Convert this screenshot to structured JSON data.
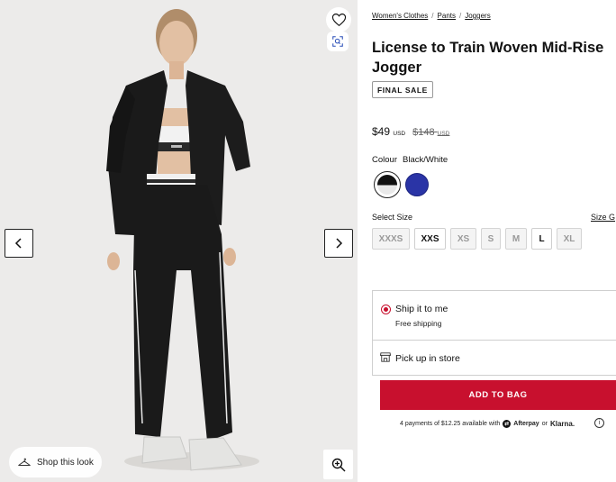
{
  "gallery": {
    "shop_look_label": "Shop this look",
    "icons": {
      "wishlist": "heart-icon",
      "visual_search": "visual-search-icon",
      "prev": "chevron-left-icon",
      "next": "chevron-right-icon",
      "zoom": "zoom-in-icon",
      "shop_look": "hanger-icon"
    }
  },
  "breadcrumb": [
    {
      "label": "Women's Clothes"
    },
    {
      "label": "Pants"
    },
    {
      "label": "Joggers"
    }
  ],
  "breadcrumb_separator": "/",
  "product": {
    "title": "License to Train Woven Mid-Rise Jogger",
    "badge": "FINAL SALE",
    "price_now": "$49",
    "price_now_currency": "USD",
    "price_old": "$148",
    "price_old_currency": "USD",
    "colour_label": "Colour",
    "colour_selected": "Black/White",
    "swatches": [
      {
        "name": "Black/White",
        "color": "#111111",
        "selected": true
      },
      {
        "name": "Blue",
        "color": "#2a34a6",
        "selected": false
      }
    ],
    "size_label": "Select Size",
    "size_guide_label": "Size G",
    "sizes": [
      {
        "label": "XXXS",
        "available": false
      },
      {
        "label": "XXS",
        "available": true
      },
      {
        "label": "XS",
        "available": false
      },
      {
        "label": "S",
        "available": false
      },
      {
        "label": "M",
        "available": false
      },
      {
        "label": "L",
        "available": true
      },
      {
        "label": "XL",
        "available": false
      }
    ]
  },
  "fulfilment": {
    "ship_title": "Ship it to me",
    "ship_subtitle": "Free shipping",
    "pickup_label": "Pick up in store"
  },
  "cta": {
    "add_to_bag": "ADD TO BAG"
  },
  "payment": {
    "text": "4 payments of $12.25 available with",
    "afterpay": "Afterpay",
    "or": "or",
    "klarna": "Klarna."
  },
  "colors": {
    "accent": "#c8102e",
    "text": "#111111",
    "gallery_bg": "#ecebea"
  }
}
